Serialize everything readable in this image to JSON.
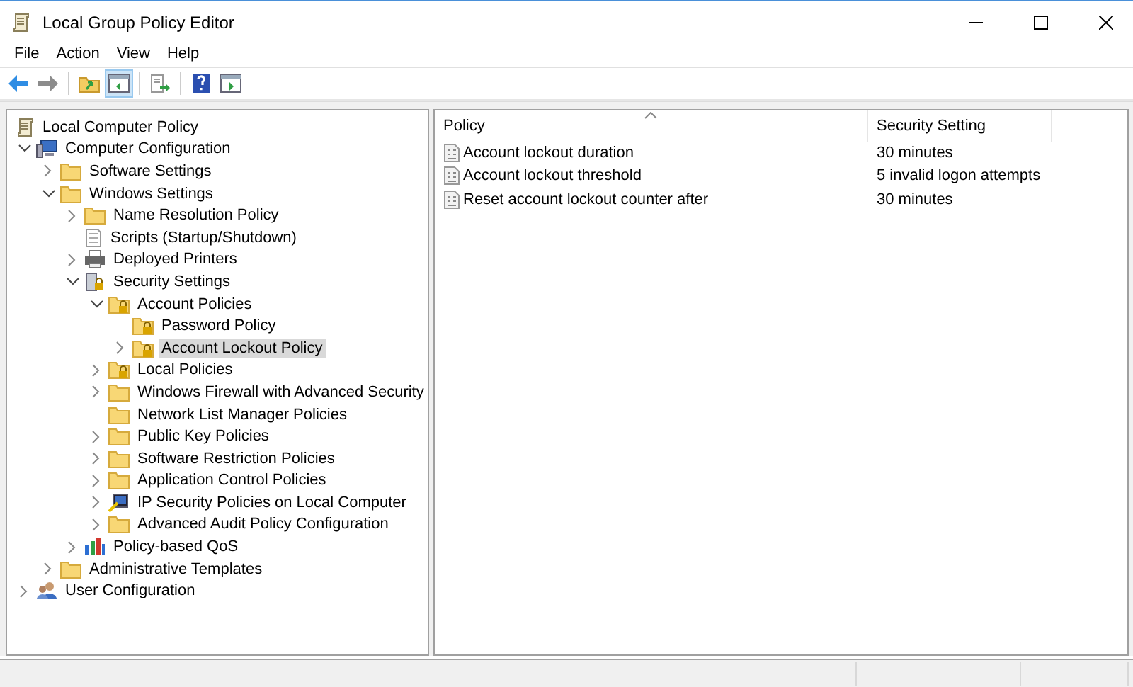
{
  "window": {
    "title": "Local Group Policy Editor"
  },
  "menu": [
    "File",
    "Action",
    "View",
    "Help"
  ],
  "toolbar": [
    {
      "kind": "back",
      "pressed": false
    },
    {
      "kind": "forward",
      "pressed": false
    },
    {
      "kind": "sep"
    },
    {
      "kind": "up",
      "pressed": false
    },
    {
      "kind": "tree",
      "pressed": true
    },
    {
      "kind": "sep"
    },
    {
      "kind": "export",
      "pressed": false
    },
    {
      "kind": "sep"
    },
    {
      "kind": "help",
      "pressed": false
    },
    {
      "kind": "pane",
      "pressed": false
    }
  ],
  "tree": [
    {
      "label": "Local Computer Policy",
      "kind": "policy",
      "selected": false,
      "children": [
        {
          "label": "Computer Configuration",
          "kind": "computer",
          "expanded": true,
          "selected": false,
          "children": [
            {
              "label": "Software Settings",
              "kind": "folder",
              "expanded": false,
              "selected": false
            },
            {
              "label": "Windows Settings",
              "kind": "folder",
              "expanded": true,
              "selected": false,
              "children": [
                {
                  "label": "Name Resolution Policy",
                  "kind": "folder",
                  "expanded": false,
                  "selected": false
                },
                {
                  "label": "Scripts (Startup/Shutdown)",
                  "kind": "script",
                  "selected": false
                },
                {
                  "label": "Deployed Printers",
                  "kind": "printer",
                  "expanded": false,
                  "selected": false
                },
                {
                  "label": "Security Settings",
                  "kind": "security",
                  "expanded": true,
                  "selected": false,
                  "children": [
                    {
                      "label": "Account Policies",
                      "kind": "lockfolder",
                      "expanded": true,
                      "selected": false,
                      "children": [
                        {
                          "label": "Password Policy",
                          "kind": "lockfolder",
                          "selected": false
                        },
                        {
                          "label": "Account Lockout Policy",
                          "kind": "lockfolder",
                          "expanded": false,
                          "selected": true
                        }
                      ]
                    },
                    {
                      "label": "Local Policies",
                      "kind": "lockfolder",
                      "expanded": false,
                      "selected": false
                    },
                    {
                      "label": "Windows Firewall with Advanced Security",
                      "kind": "folder",
                      "expanded": false,
                      "selected": false
                    },
                    {
                      "label": "Network List Manager Policies",
                      "kind": "folder",
                      "selected": false
                    },
                    {
                      "label": "Public Key Policies",
                      "kind": "folder",
                      "expanded": false,
                      "selected": false
                    },
                    {
                      "label": "Software Restriction Policies",
                      "kind": "folder",
                      "expanded": false,
                      "selected": false
                    },
                    {
                      "label": "Application Control Policies",
                      "kind": "folder",
                      "expanded": false,
                      "selected": false
                    },
                    {
                      "label": "IP Security Policies on Local Computer",
                      "kind": "ip",
                      "expanded": false,
                      "selected": false
                    },
                    {
                      "label": "Advanced Audit Policy Configuration",
                      "kind": "folder",
                      "expanded": false,
                      "selected": false
                    }
                  ]
                },
                {
                  "label": "Policy-based QoS",
                  "kind": "chart",
                  "expanded": false,
                  "selected": false
                }
              ]
            },
            {
              "label": "Administrative Templates",
              "kind": "folder",
              "expanded": false,
              "selected": false
            }
          ]
        },
        {
          "label": "User Configuration",
          "kind": "user",
          "expanded": false,
          "selected": false
        }
      ]
    }
  ],
  "table": {
    "columns": [
      "Policy",
      "Security Setting"
    ],
    "rows": [
      {
        "policy": "Account lockout duration",
        "setting": "30 minutes"
      },
      {
        "policy": "Account lockout threshold",
        "setting": "5 invalid logon attempts"
      },
      {
        "policy": "Reset account lockout counter after",
        "setting": "30 minutes"
      }
    ]
  }
}
